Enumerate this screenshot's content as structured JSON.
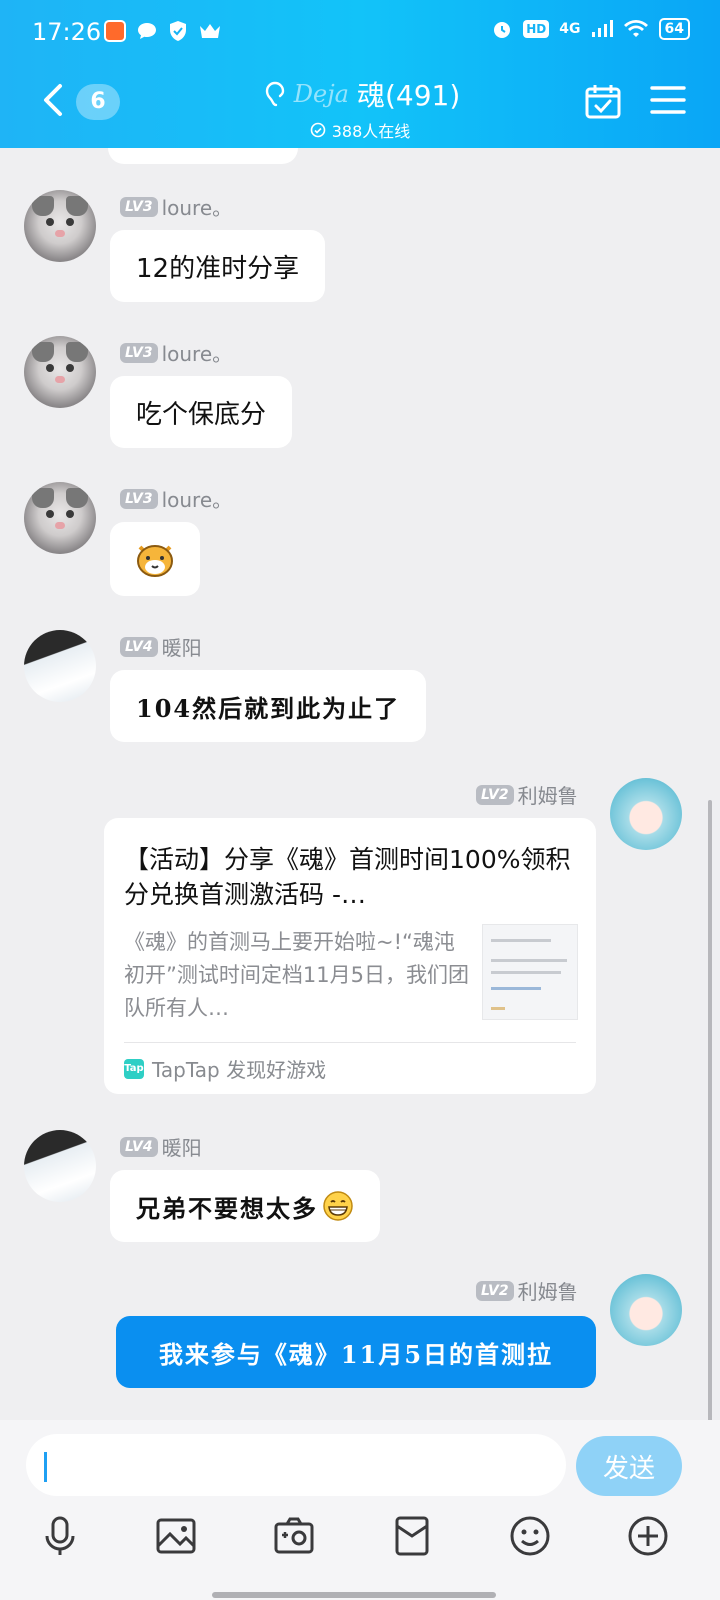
{
  "status_bar": {
    "time": "17:26",
    "network": "4G",
    "hd": "HD",
    "battery": "64"
  },
  "header": {
    "unread_count": "6",
    "logo_text": "Deja",
    "title": "魂(491)",
    "online": "388人在线",
    "icons": [
      "back-icon",
      "ear-icon",
      "checkin-calendar-icon",
      "menu-icon"
    ]
  },
  "messages": [
    {
      "level": "LV3",
      "name": "loure。",
      "text": "12的准时分享"
    },
    {
      "level": "LV3",
      "name": "loure。",
      "text": "吃个保底分"
    },
    {
      "level": "LV3",
      "name": "loure。",
      "text": ""
    },
    {
      "level": "LV4",
      "name": "暖阳",
      "text": "104然后就到此为止了"
    },
    {
      "level": "LV2",
      "name": "利姆鲁"
    },
    {
      "level": "LV4",
      "name": "暖阳",
      "text": "兄弟不要想太多"
    },
    {
      "level": "LV2",
      "name": "利姆鲁",
      "text": "我来参与《魂》11月5日的首测拉"
    }
  ],
  "link_card": {
    "title": "【活动】分享《魂》首测时间100%领积分兑换首测激活码 -…",
    "description": "《魂》的首测马上要开始啦~!“魂沌初开”测试时间定档11月5日，我们团队所有人…",
    "source_icon": "Tap",
    "source": "TapTap 发现好游戏"
  },
  "composer": {
    "input_value": "",
    "send_label": "发送"
  },
  "toolbar_icons": [
    "microphone-icon",
    "image-icon",
    "camera-icon",
    "red-packet-icon",
    "emoji-icon",
    "plus-icon"
  ]
}
